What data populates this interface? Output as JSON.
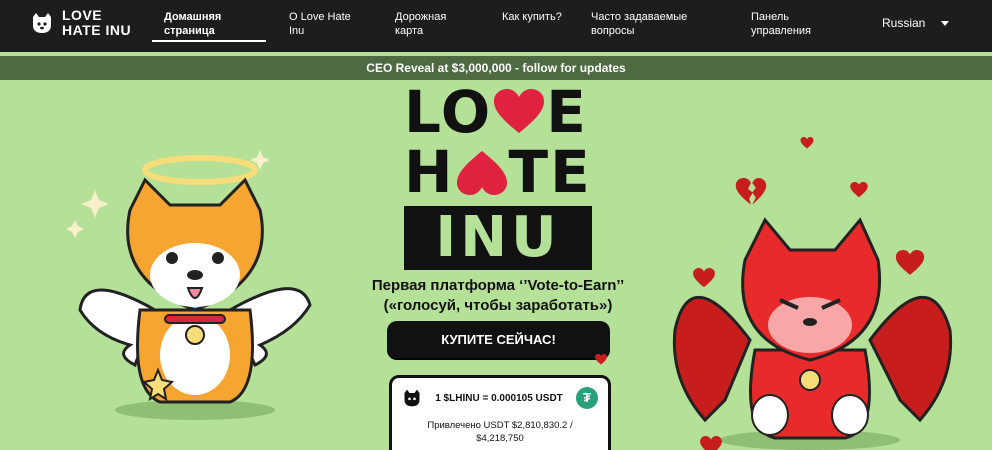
{
  "brand": {
    "name": "LOVE HATE INU"
  },
  "nav": {
    "items": [
      {
        "label": "Домашняя страница",
        "active": true
      },
      {
        "label": "О Love Hate Inu"
      },
      {
        "label": "Дорожная карта"
      },
      {
        "label": "Как купить?"
      },
      {
        "label": "Часто задаваемые вопросы"
      },
      {
        "label": "Панель управления"
      }
    ],
    "language": "Russian"
  },
  "banner": {
    "text": "CEO Reveal at $3,000,000 - follow for updates"
  },
  "hero": {
    "logo_line1": "LOVE",
    "logo_line2": "HATE",
    "logo_line3": "INU",
    "tagline": "Первая платформа ‘’Vote-to-Earn’’ («голосуй, чтобы заработать»)",
    "buy_button": "КУПИТЕ СЕЙЧАС!",
    "presale": {
      "price": "1 $LHINU = 0.000105 USDT",
      "raised": "Привлечено USDT $2,810,830.2 / $4,218,750"
    }
  },
  "colors": {
    "background": "#b4e097",
    "nav": "#1d1d1d",
    "banner": "#4e6a42",
    "heart": "#e0213f"
  }
}
